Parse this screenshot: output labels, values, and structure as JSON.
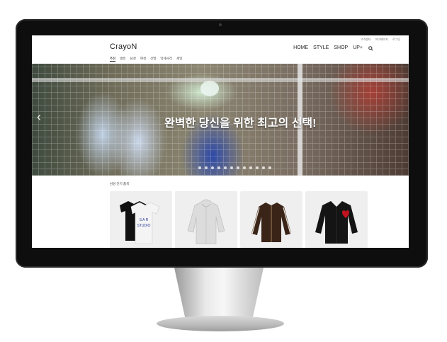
{
  "site": {
    "logo": "CrayoN",
    "util_links": [
      "고객센터",
      "마이페이지",
      "로그인"
    ],
    "subnav": [
      "추천",
      "랭킹",
      "남성",
      "여성",
      "신발",
      "악세사리",
      "세일"
    ],
    "mainnav": [
      "HOME",
      "STYLE",
      "SHOP",
      "UP+"
    ]
  },
  "hero": {
    "headline": "완벽한 당신을 위한 최고의 선택!",
    "slide_count": 12,
    "prev_glyph": "‹"
  },
  "section": {
    "title": "남성 인기 품목"
  },
  "products": [
    {
      "name": "tshirt-set",
      "image_text": "S A R\nSTUDIO"
    },
    {
      "name": "grey-hoodie"
    },
    {
      "name": "brown-track-jacket"
    },
    {
      "name": "black-cardigan"
    }
  ],
  "colors": {
    "bezel": "#0e0e0e",
    "page_bg": "#ffffff",
    "card_bg": "#efefef",
    "hero_text": "#ffffff",
    "cardigan_heart": "#c1121f"
  },
  "device": {
    "apple_logo": ""
  }
}
